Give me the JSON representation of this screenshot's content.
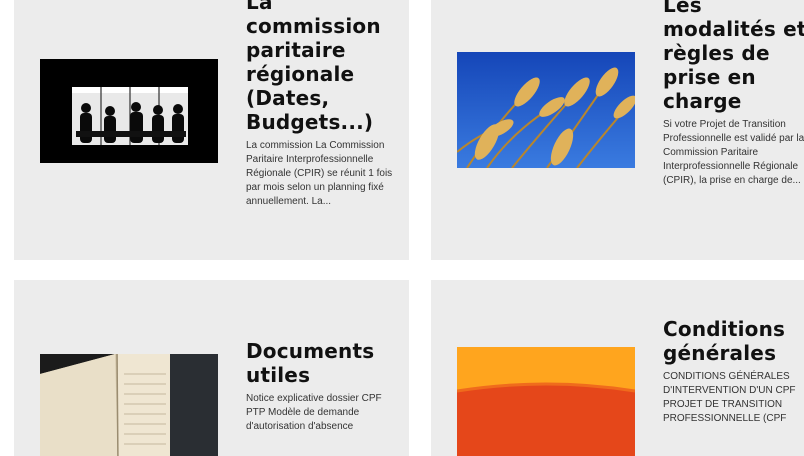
{
  "cards": [
    {
      "title": "La commission paritaire régionale (Dates, Budgets...)",
      "excerpt": "La commission  La Commission Paritaire Interprofessionnelle Régionale (CPIR) se réunit 1 fois par mois selon un planning fixé annuellement. La..."
    },
    {
      "title": "Les modalités et règles de prise en charge",
      "excerpt": "Si votre Projet de Transition Professionnelle est validé par la Commission Paritaire Interprofessionnelle Régionale (CPIR), la prise en charge de..."
    },
    {
      "title": "Documents utiles",
      "excerpt": " Notice explicative dossier CPF PTP Modèle de demande d'autorisation d'absence"
    },
    {
      "title": "Conditions générales",
      "excerpt": "CONDITIONS GÉNÉRALES D'INTERVENTION D'UN CPF PROJET DE TRANSITION PROFESSIONNELLE (CPF"
    }
  ]
}
